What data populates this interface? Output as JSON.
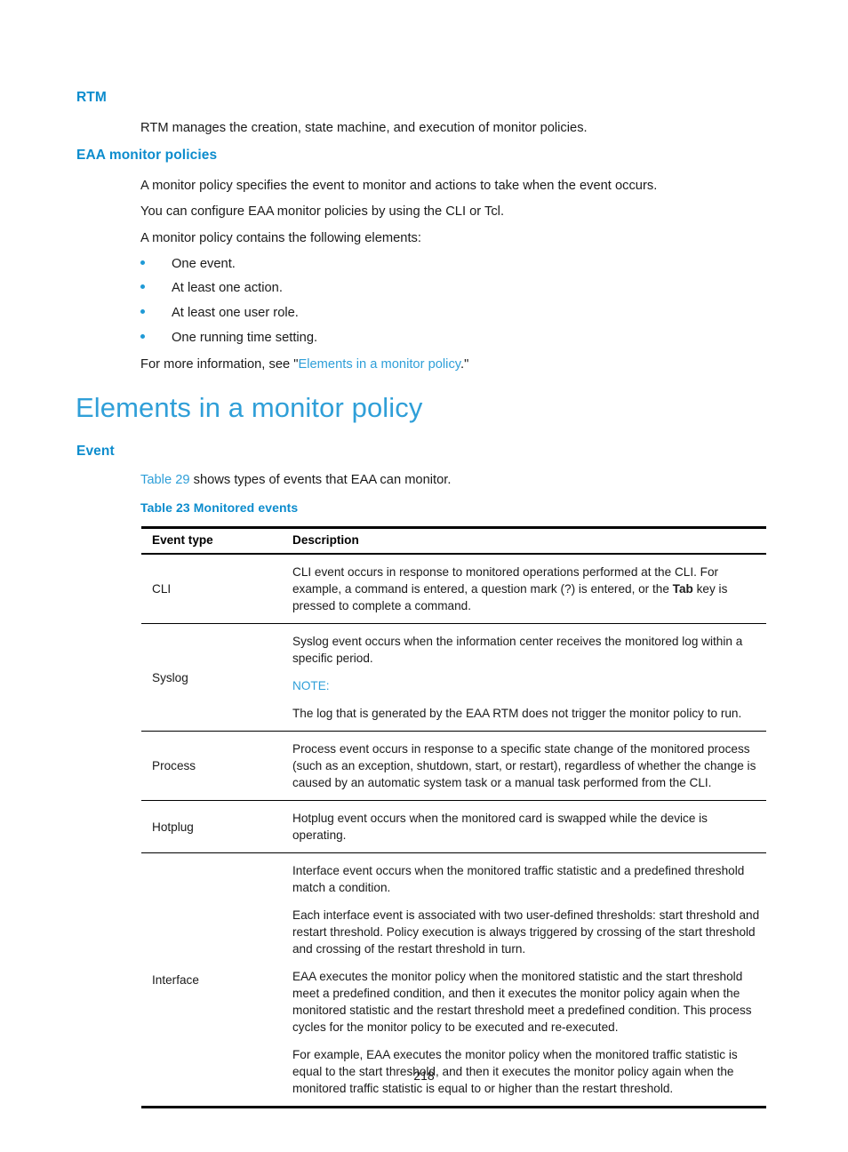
{
  "document": {
    "page_number": "218"
  },
  "sections": {
    "rtm": {
      "heading": "RTM",
      "paragraph": "RTM manages the creation, state machine, and execution of monitor policies."
    },
    "eaa_monitor_policies": {
      "heading": "EAA monitor policies",
      "paragraph_1": "A monitor policy specifies the event to monitor and actions to take when the event occurs.",
      "paragraph_2": "You can configure EAA monitor policies by using the CLI or Tcl.",
      "paragraph_3": "A monitor policy contains the following elements:",
      "bullets": [
        "One event.",
        "At least one action.",
        "At least one user role.",
        "One running time setting."
      ],
      "see_also_prefix": "For more information, see \"",
      "see_also_link": "Elements in a monitor policy",
      "see_also_suffix": ".\""
    },
    "elements_in_a_monitor_policy": {
      "heading": "Elements in a monitor policy",
      "event_heading": "Event",
      "intro_link": "Table 29",
      "intro_rest": " shows types of events that EAA can monitor.",
      "table_caption": "Table 23 Monitored events"
    }
  },
  "table": {
    "columns": [
      "Event type",
      "Description"
    ],
    "rows": [
      {
        "event_type": "CLI",
        "description_parts": {
          "before_bold": "CLI event occurs in response to monitored operations performed at the CLI. For example, a command is entered, a question mark (?) is entered, or the ",
          "bold": "Tab",
          "after_bold": " key is pressed to complete a command."
        }
      },
      {
        "event_type": "Syslog",
        "paragraph_1": "Syslog event occurs when the information center receives the monitored log within a specific period.",
        "note_label": "NOTE:",
        "note_text": "The log that is generated by the EAA RTM does not trigger the monitor policy to run."
      },
      {
        "event_type": "Process",
        "paragraph_1": "Process event occurs in response to a specific state change of the monitored process (such as an exception, shutdown, start, or restart), regardless of whether the change is caused by an automatic system task or a manual task performed from the CLI."
      },
      {
        "event_type": "Hotplug",
        "paragraph_1": "Hotplug event occurs when the monitored card is swapped while the device is operating."
      },
      {
        "event_type": "Interface",
        "paragraph_1": "Interface event occurs when the monitored traffic statistic and a predefined threshold match a condition.",
        "paragraph_2": "Each interface event is associated with two user-defined thresholds: start threshold and restart threshold. Policy execution is always triggered by crossing of the start threshold and crossing of the restart threshold in turn.",
        "paragraph_3": "EAA executes the monitor policy when the monitored statistic and the start threshold meet a predefined condition, and then it executes the monitor policy again when the monitored statistic and the restart threshold meet a predefined condition. This process cycles for the monitor policy to be executed and re-executed.",
        "paragraph_4": "For example, EAA executes the monitor policy when the monitored traffic statistic is equal to the start threshold, and then it executes the monitor policy again when the monitored traffic statistic is equal to or higher than the restart threshold."
      }
    ]
  },
  "colors": {
    "heading_blue": "#0c8ccd",
    "title_blue": "#2f9fd8",
    "link_blue": "#2f9fd8",
    "bullet_blue": "#1f9ad6",
    "text_black": "#1a1a1a"
  }
}
